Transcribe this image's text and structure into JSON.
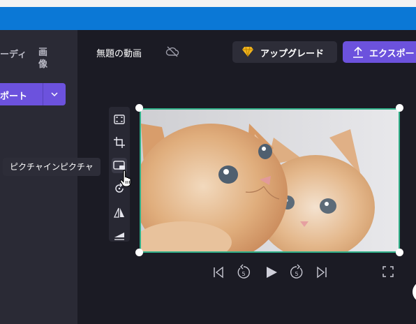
{
  "sidebar": {
    "audio_label": "ーディ",
    "image_label": "画像",
    "import_label": "ポート"
  },
  "header": {
    "project_title": "無題の動画",
    "upgrade_label": "アップグレード",
    "export_label": "エクスポー"
  },
  "toolbar": {
    "tooltip": "ピクチャインピクチャ",
    "tools": [
      "fit-icon",
      "crop-icon",
      "picture-in-picture-icon",
      "rotate-icon",
      "flip-icon",
      "fade-icon"
    ]
  },
  "player": {
    "rewind_seconds": "5",
    "forward_seconds": "5"
  },
  "colors": {
    "accent": "#6c52dd",
    "selection": "#30b089",
    "brand_bar": "#0b78d6"
  }
}
